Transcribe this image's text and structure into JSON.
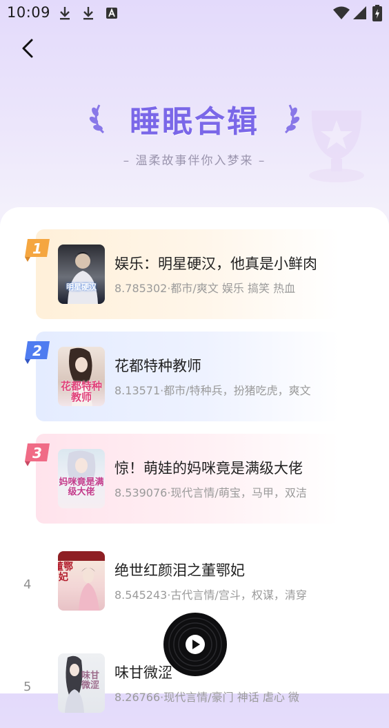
{
  "status_bar": {
    "time": "10:09",
    "icons": [
      "download-icon",
      "download-icon",
      "keyboard-a-icon",
      "wifi-icon",
      "signal-icon",
      "battery-icon"
    ]
  },
  "header": {
    "back_icon": "back-arrow-icon",
    "title": "睡眠合辑",
    "subtitle": "– 温柔故事伴你入梦来 –"
  },
  "colors": {
    "accent": "#7a67e8",
    "rank1": "#f5a640",
    "rank2": "#4f7cf0",
    "rank3": "#f06b86"
  },
  "books": [
    {
      "rank": "1",
      "title": "娱乐：明星硬汉，他真是小鲜肉",
      "meta": "8.785302·都市/爽文 娱乐 搞笑 热血",
      "cover_text": "明星硬汉"
    },
    {
      "rank": "2",
      "title": "花都特种教师",
      "meta": "8.13571·都市/特种兵，扮猪吃虎，爽文",
      "cover_text": "花都特种教师"
    },
    {
      "rank": "3",
      "title": "惊！萌娃的妈咪竟是满级大佬",
      "meta": "8.539076·现代言情/萌宝，马甲，双洁",
      "cover_text": "妈咪竟是满级大佬"
    },
    {
      "rank": "4",
      "title": "绝世红颜泪之董鄂妃",
      "meta": "8.545243·古代言情/宫斗，权谋，清穿",
      "cover_text": "董鄂妃"
    },
    {
      "rank": "5",
      "title": "味甘微涩",
      "meta": "8.26766·现代言情/豪门 神话 虐心 微",
      "cover_text": "味甘微涩"
    }
  ],
  "player": {
    "icon": "play-icon"
  }
}
